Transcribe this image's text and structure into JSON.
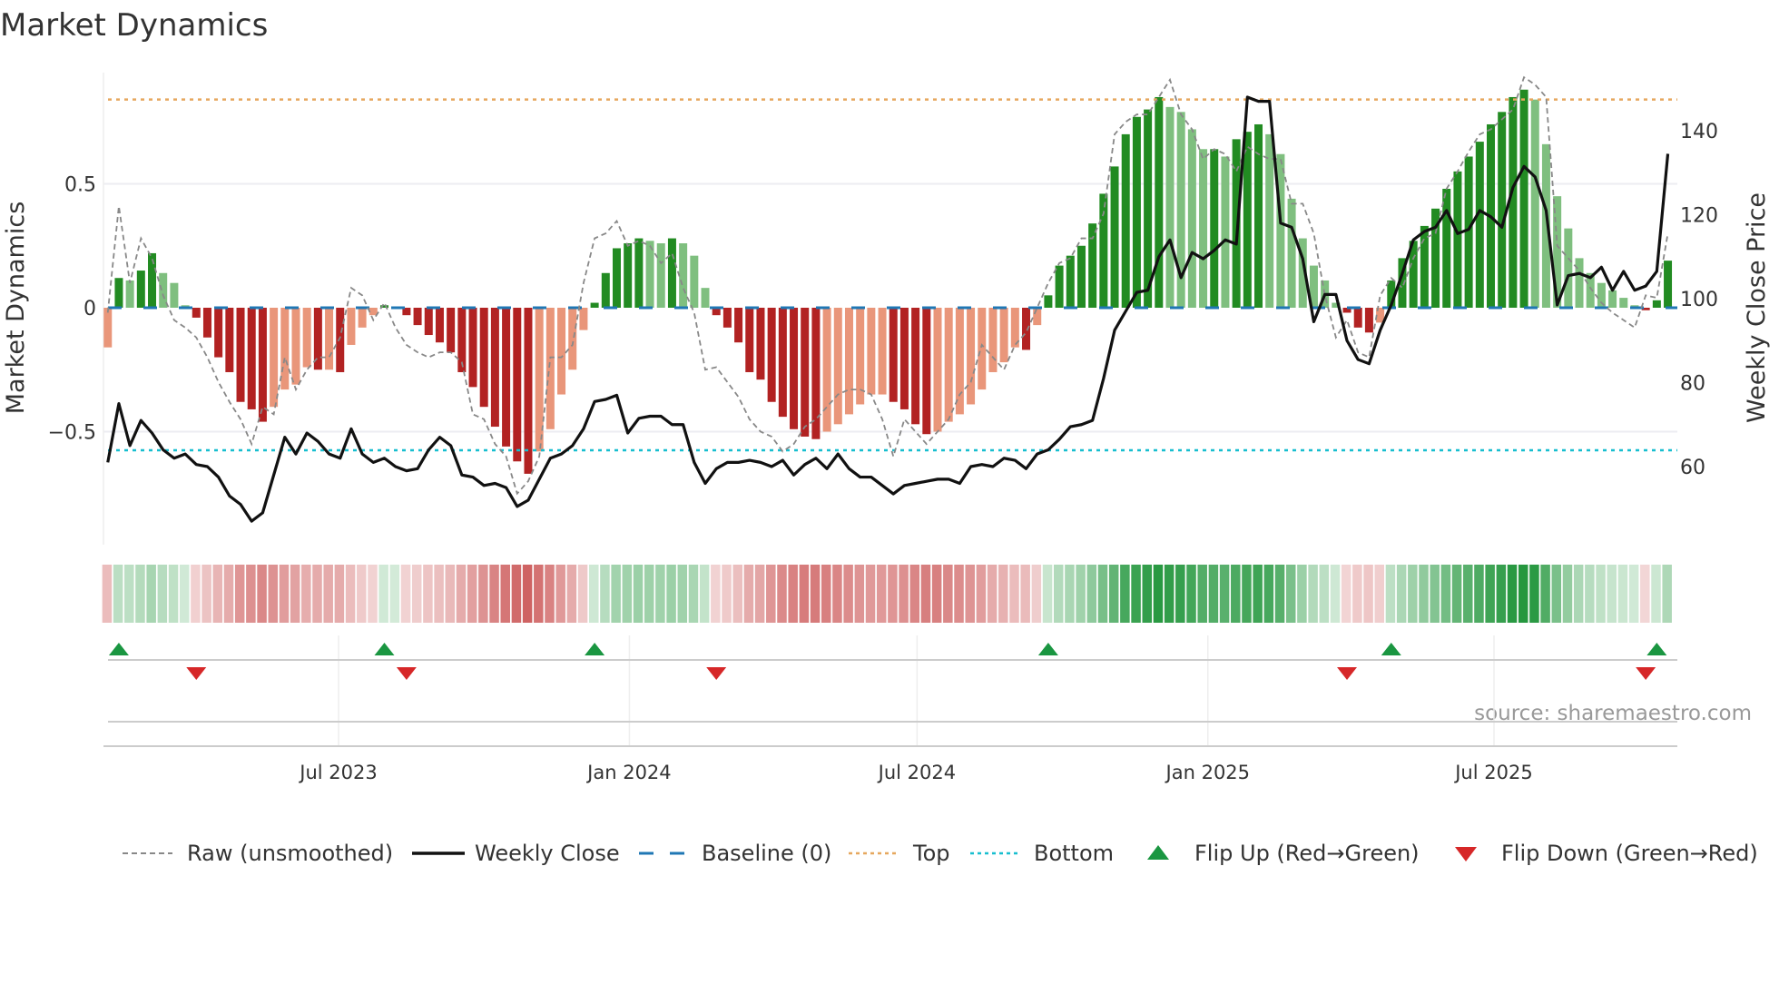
{
  "title": "Market Dynamics",
  "source": "source: sharemaestro.com",
  "colors": {
    "up_strong": "#228b22",
    "up_weak": "#7fbf7f",
    "down_strong": "#b22222",
    "down_weak": "#e9967a",
    "price": "#111111",
    "raw": "#888888",
    "baseline": "#1f77b4",
    "top": "#e6a75e",
    "bottom": "#17becf",
    "flip_up": "#1a9641",
    "flip_down": "#d62728"
  },
  "chart_data": {
    "type": "bar",
    "title": "Market Dynamics",
    "ylabel": "Market Dynamics",
    "y2label": "Weekly Close Price",
    "ylim": [
      -0.95,
      0.95
    ],
    "y2lim": [
      40,
      155
    ],
    "yticks": [
      {
        "v": 0.5,
        "label": "0.5"
      },
      {
        "v": 0,
        "label": "0"
      },
      {
        "v": -0.5,
        "label": "−0.5"
      }
    ],
    "y2ticks": [
      {
        "v": 140,
        "label": "140"
      },
      {
        "v": 120,
        "label": "120"
      },
      {
        "v": 100,
        "label": "100"
      },
      {
        "v": 80,
        "label": "80"
      },
      {
        "v": 60,
        "label": "60"
      }
    ],
    "start_date": "2023-02-05",
    "frequency": "weekly",
    "xticks": [
      {
        "date": "2023-07-01",
        "label": "Jul 2023"
      },
      {
        "date": "2024-01-01",
        "label": "Jan 2024"
      },
      {
        "date": "2024-07-01",
        "label": "Jul 2024"
      },
      {
        "date": "2025-01-01",
        "label": "Jan 2025"
      },
      {
        "date": "2025-07-01",
        "label": "Jul 2025"
      }
    ],
    "top_level": 0.84,
    "bottom_level": -0.575,
    "baseline": 0,
    "smoothed": [
      -0.16,
      0.12,
      0.11,
      0.15,
      0.22,
      0.14,
      0.1,
      0.01,
      -0.04,
      -0.12,
      -0.2,
      -0.26,
      -0.38,
      -0.41,
      -0.46,
      -0.4,
      -0.33,
      -0.31,
      -0.24,
      -0.25,
      -0.25,
      -0.26,
      -0.15,
      -0.08,
      -0.03,
      0.01,
      0.005,
      -0.03,
      -0.07,
      -0.11,
      -0.14,
      -0.18,
      -0.26,
      -0.32,
      -0.4,
      -0.48,
      -0.56,
      -0.62,
      -0.67,
      -0.58,
      -0.49,
      -0.35,
      -0.25,
      -0.09,
      0.02,
      0.14,
      0.24,
      0.26,
      0.28,
      0.27,
      0.26,
      0.28,
      0.26,
      0.21,
      0.08,
      -0.03,
      -0.08,
      -0.14,
      -0.26,
      -0.29,
      -0.38,
      -0.44,
      -0.49,
      -0.52,
      -0.53,
      -0.5,
      -0.47,
      -0.43,
      -0.39,
      -0.35,
      -0.35,
      -0.38,
      -0.41,
      -0.47,
      -0.51,
      -0.5,
      -0.46,
      -0.43,
      -0.39,
      -0.33,
      -0.26,
      -0.22,
      -0.16,
      -0.17,
      -0.07,
      0.05,
      0.17,
      0.21,
      0.25,
      0.34,
      0.46,
      0.57,
      0.7,
      0.77,
      0.8,
      0.85,
      0.81,
      0.79,
      0.72,
      0.64,
      0.64,
      0.61,
      0.68,
      0.71,
      0.74,
      0.7,
      0.62,
      0.44,
      0.28,
      0.17,
      0.11,
      0.02,
      -0.02,
      -0.08,
      -0.1,
      -0.06,
      0.11,
      0.2,
      0.27,
      0.33,
      0.4,
      0.48,
      0.55,
      0.61,
      0.67,
      0.74,
      0.79,
      0.85,
      0.88,
      0.84,
      0.66,
      0.45,
      0.32,
      0.2,
      0.14,
      0.1,
      0.07,
      0.04,
      0.01,
      -0.01,
      0.03,
      0.19
    ],
    "raw": [
      -0.02,
      0.41,
      0.1,
      0.28,
      0.2,
      0.05,
      -0.05,
      -0.08,
      -0.12,
      -0.2,
      -0.3,
      -0.38,
      -0.45,
      -0.55,
      -0.4,
      -0.43,
      -0.2,
      -0.33,
      -0.25,
      -0.2,
      -0.2,
      -0.12,
      0.08,
      0.05,
      -0.05,
      0.02,
      -0.08,
      -0.15,
      -0.18,
      -0.2,
      -0.18,
      -0.18,
      -0.22,
      -0.43,
      -0.45,
      -0.55,
      -0.6,
      -0.75,
      -0.7,
      -0.6,
      -0.2,
      -0.2,
      -0.15,
      0.1,
      0.28,
      0.3,
      0.35,
      0.25,
      0.27,
      0.25,
      0.18,
      0.22,
      0.08,
      -0.02,
      -0.25,
      -0.24,
      -0.3,
      -0.36,
      -0.45,
      -0.5,
      -0.52,
      -0.58,
      -0.55,
      -0.48,
      -0.45,
      -0.4,
      -0.35,
      -0.33,
      -0.33,
      -0.35,
      -0.45,
      -0.6,
      -0.45,
      -0.5,
      -0.55,
      -0.5,
      -0.45,
      -0.35,
      -0.3,
      -0.15,
      -0.2,
      -0.25,
      -0.15,
      -0.1,
      0.0,
      0.1,
      0.18,
      0.2,
      0.28,
      0.28,
      0.38,
      0.7,
      0.75,
      0.78,
      0.78,
      0.85,
      0.92,
      0.78,
      0.72,
      0.6,
      0.64,
      0.62,
      0.55,
      0.65,
      0.62,
      0.6,
      0.6,
      0.42,
      0.42,
      0.3,
      0.05,
      -0.12,
      -0.05,
      -0.18,
      -0.2,
      0.05,
      0.12,
      0.08,
      0.2,
      0.28,
      0.3,
      0.48,
      0.55,
      0.63,
      0.7,
      0.72,
      0.76,
      0.8,
      0.93,
      0.9,
      0.85,
      0.25,
      0.2,
      0.15,
      0.08,
      0.02,
      -0.02,
      -0.05,
      -0.08,
      0.05,
      0.04,
      0.3
    ],
    "price": [
      61,
      75,
      65,
      71,
      68,
      64,
      62,
      63,
      60.5,
      60,
      57.5,
      53,
      51,
      47,
      49,
      58,
      67,
      63,
      68,
      66,
      63,
      62,
      69,
      63,
      61,
      62,
      60,
      59,
      59.5,
      64,
      67,
      65,
      58,
      57.5,
      55.5,
      56,
      55,
      50.5,
      52,
      57,
      62,
      63,
      65,
      69,
      75.5,
      76,
      77,
      68,
      71.5,
      72,
      72,
      70,
      70,
      61,
      56,
      59.5,
      61,
      61,
      61.5,
      61,
      60,
      61.5,
      58,
      60.5,
      62,
      59.5,
      63,
      59.5,
      57.5,
      57.5,
      55.5,
      53.5,
      55.5,
      56,
      56.5,
      57,
      57,
      56,
      60,
      60.5,
      60,
      62,
      61.5,
      59.5,
      63,
      64,
      66.5,
      69.5,
      70,
      71,
      81,
      92.5,
      97,
      101.5,
      102,
      110,
      114,
      105,
      111,
      109.5,
      111.5,
      114,
      113,
      148,
      147,
      147,
      118,
      117,
      109.5,
      94.5,
      101,
      101,
      90,
      85.5,
      84.5,
      92.5,
      98.5,
      106,
      114,
      116,
      117,
      121,
      115.5,
      116.5,
      121,
      119.5,
      117,
      126.5,
      131.5,
      129,
      121,
      98.5,
      105.5,
      106,
      105,
      107.5,
      102,
      106.5,
      102,
      103,
      106.5,
      134.5
    ],
    "flips": {
      "up": [
        1,
        25,
        44,
        85,
        116,
        140
      ],
      "down": [
        8,
        27,
        55,
        112,
        139
      ]
    }
  },
  "legend": [
    {
      "key": "raw",
      "label": "Raw (unsmoothed)"
    },
    {
      "key": "price",
      "label": "Weekly Close"
    },
    {
      "key": "baseline",
      "label": "Baseline (0)"
    },
    {
      "key": "top",
      "label": "Top"
    },
    {
      "key": "bottom",
      "label": "Bottom"
    },
    {
      "key": "flip_up",
      "label": "Flip Up (Red→Green)"
    },
    {
      "key": "flip_down",
      "label": "Flip Down (Green→Red)"
    }
  ]
}
